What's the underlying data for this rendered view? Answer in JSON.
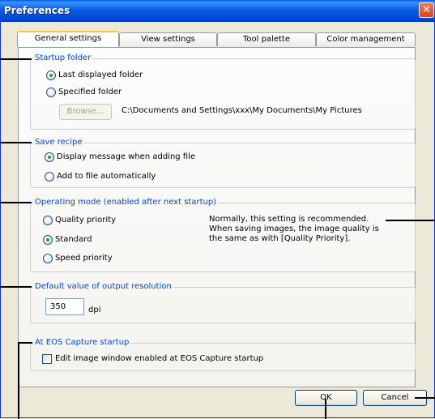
{
  "window": {
    "title": "Preferences",
    "close_glyph": "✕"
  },
  "tabs": [
    {
      "label": "General settings",
      "active": true
    },
    {
      "label": "View settings",
      "active": false
    },
    {
      "label": "Tool palette",
      "active": false
    },
    {
      "label": "Color management",
      "active": false
    }
  ],
  "startup_folder": {
    "legend": "Startup folder",
    "option_last": "Last displayed folder",
    "option_specified": "Specified folder",
    "selected": "Last displayed folder",
    "browse_label": "Browse...",
    "path": "C:\\Documents and Settings\\xxx\\My Documents\\My Pictures"
  },
  "save_recipe": {
    "legend": "Save recipe",
    "option_message": "Display message when adding file",
    "option_auto": "Add to file automatically",
    "selected": "Display message when adding file"
  },
  "operating_mode": {
    "legend": "Operating mode (enabled after next startup)",
    "option_quality": "Quality priority",
    "option_standard": "Standard",
    "option_speed": "Speed priority",
    "selected": "Standard",
    "note_line1": "Normally, this setting is recommended.",
    "note_line2": "When saving images, the image quality is",
    "note_line3": "the same as with [Quality Priority]."
  },
  "output_resolution": {
    "legend": "Default value of output resolution",
    "value": "350",
    "unit": "dpi"
  },
  "eos_capture": {
    "legend": "At EOS Capture startup",
    "checkbox_label": "Edit image window enabled at EOS Capture startup",
    "checked": false
  },
  "buttons": {
    "ok": "OK",
    "cancel": "Cancel"
  },
  "colors": {
    "legend_text": "#0046d5",
    "title_bar": "#0058e6",
    "window_bg": "#ece9d8"
  }
}
